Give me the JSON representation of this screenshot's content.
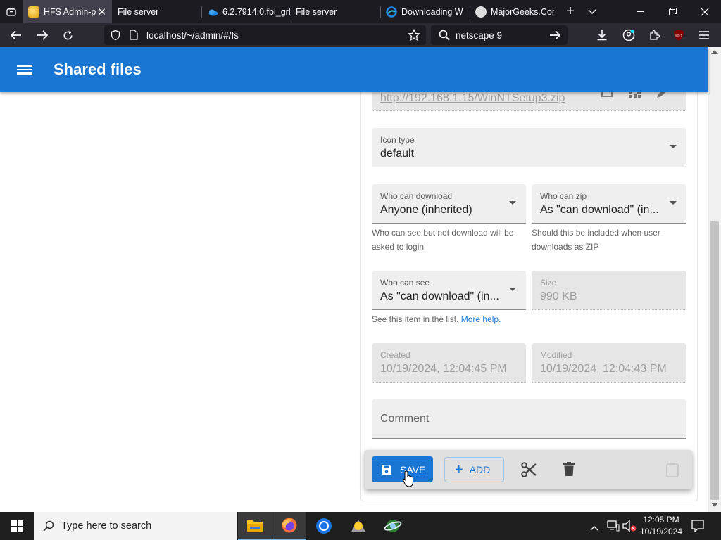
{
  "browser": {
    "tabs": [
      {
        "title": "HFS Admin-p",
        "active": true
      },
      {
        "title": "File server"
      },
      {
        "title": "6.2.7914.0.fbl_grl"
      },
      {
        "title": "File server"
      },
      {
        "title": "Downloading W"
      },
      {
        "title": "MajorGeeks.Com"
      }
    ],
    "url": "localhost/~/admin/#/fs",
    "search_text": "netscape 9",
    "extension_badge": "UD"
  },
  "app": {
    "title": "Shared files",
    "url_field_value": "http://192.168.1.15/WinNTSetup3.zip",
    "icon_type": {
      "label": "Icon type",
      "value": "default"
    },
    "who_can_download": {
      "label": "Who can download",
      "value": "Anyone (inherited)",
      "help": "Who can see but not download will be asked to login"
    },
    "who_can_zip": {
      "label": "Who can zip",
      "value": "As \"can download\" (in...",
      "help": "Should this be included when user downloads as ZIP"
    },
    "who_can_see": {
      "label": "Who can see",
      "value": "As \"can download\" (in...",
      "help": "See this item in the list.",
      "help_link": "More help."
    },
    "size": {
      "label": "Size",
      "value": "990 KB"
    },
    "created": {
      "label": "Created",
      "value": "10/19/2024, 12:04:45 PM"
    },
    "modified": {
      "label": "Modified",
      "value": "10/19/2024, 12:04:43 PM"
    },
    "comment": {
      "label": "Comment"
    },
    "toolbar": {
      "save_label": "SAVE",
      "add_label": "ADD"
    }
  },
  "taskbar": {
    "search_placeholder": "Type here to search",
    "time": "12:05 PM",
    "date": "10/19/2024"
  },
  "colors": {
    "accent": "#1976d2",
    "chrome": "#1c1b22"
  }
}
